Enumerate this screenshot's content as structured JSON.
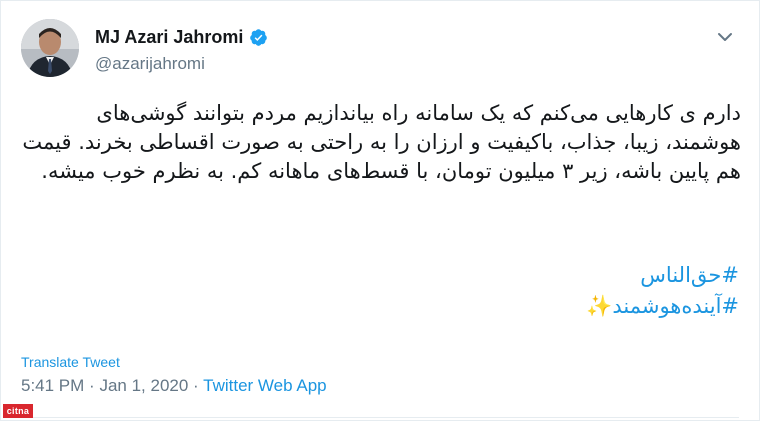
{
  "author": {
    "display_name": "MJ Azari Jahromi",
    "handle": "@azarijahromi",
    "verified": true
  },
  "tweet": {
    "text": "دارم ی کارهایی می‌کنم که یک سامانه راه بیاندازیم مردم بتوانند گوشی‌های هوشمند، زیبا، جذاب، باکیفیت و ارزان را به راحتی به صورت اقساطی بخرند. قیمت هم پایین باشه، زیر ۳ میلیون تومان، با قسط‌های ماهانه کم. به نظرم خوب میشه.",
    "hashtags": [
      "#حق‌الناس",
      "#آینده‌هوشمند"
    ],
    "hashtag_emoji": "✨"
  },
  "footer": {
    "translate_label": "Translate Tweet",
    "time": "5:41 PM",
    "date": "Jan 1, 2020",
    "separator": "·",
    "source_app": "Twitter Web App"
  },
  "watermark_text": "citna",
  "colors": {
    "link": "#1b95e0",
    "text": "#14171a",
    "muted": "#657786",
    "verified_badge": "#1da1f2",
    "sparkle": "#f5c518"
  },
  "icons": {
    "verified": "verified-badge-icon",
    "menu": "chevron-down-icon",
    "sparkle": "sparkles-emoji"
  }
}
